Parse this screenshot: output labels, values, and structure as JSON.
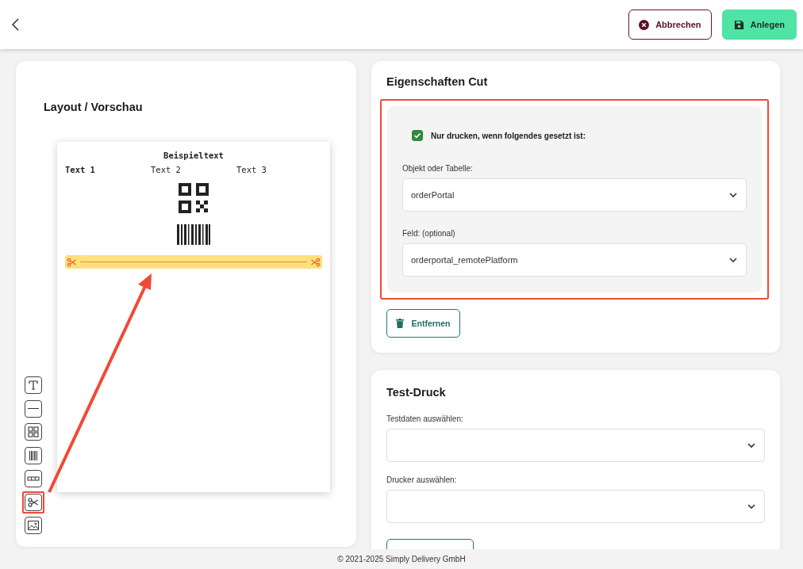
{
  "header": {
    "buttons": [
      {
        "label": "Abbrechen",
        "kind": "cancel"
      },
      {
        "label": "Anlegen",
        "kind": "save"
      }
    ]
  },
  "layout_panel": {
    "title": "Layout / Vorschau",
    "preview": {
      "heading": "Beispieltext",
      "columns": [
        {
          "text": "Text 1",
          "bold": true
        },
        {
          "text": "Text 2",
          "bold": false
        },
        {
          "text": "Text 3",
          "bold": false
        }
      ],
      "elements": [
        {
          "kind": "qr",
          "selected": false
        },
        {
          "kind": "barcode",
          "selected": false
        },
        {
          "kind": "cut",
          "selected": true
        }
      ]
    },
    "tools": [
      {
        "kind": "text",
        "highlighted": false
      },
      {
        "kind": "line",
        "highlighted": false
      },
      {
        "kind": "qr",
        "highlighted": false
      },
      {
        "kind": "barcode",
        "highlighted": false
      },
      {
        "kind": "columns",
        "highlighted": false
      },
      {
        "kind": "cut",
        "highlighted": true
      },
      {
        "kind": "image",
        "highlighted": false
      }
    ]
  },
  "properties_panel": {
    "title": "Eigenschaften Cut",
    "highlighted": true,
    "condition": {
      "label": "Nur drucken, wenn folgendes gesetzt ist:",
      "checked": true
    },
    "fields": [
      {
        "label": "Objekt oder Tabelle:",
        "value": "orderPortal"
      },
      {
        "label": "Feld: (optional)",
        "value": "orderportal_remotePlatform"
      }
    ],
    "remove_button": "Entfernen"
  },
  "test_print_panel": {
    "title": "Test-Druck",
    "fields": [
      {
        "label": "Testdaten auswählen:"
      },
      {
        "label": "Drucker auswählen:"
      }
    ]
  },
  "footer": "© 2021-2025 Simply Delivery GmbH"
}
